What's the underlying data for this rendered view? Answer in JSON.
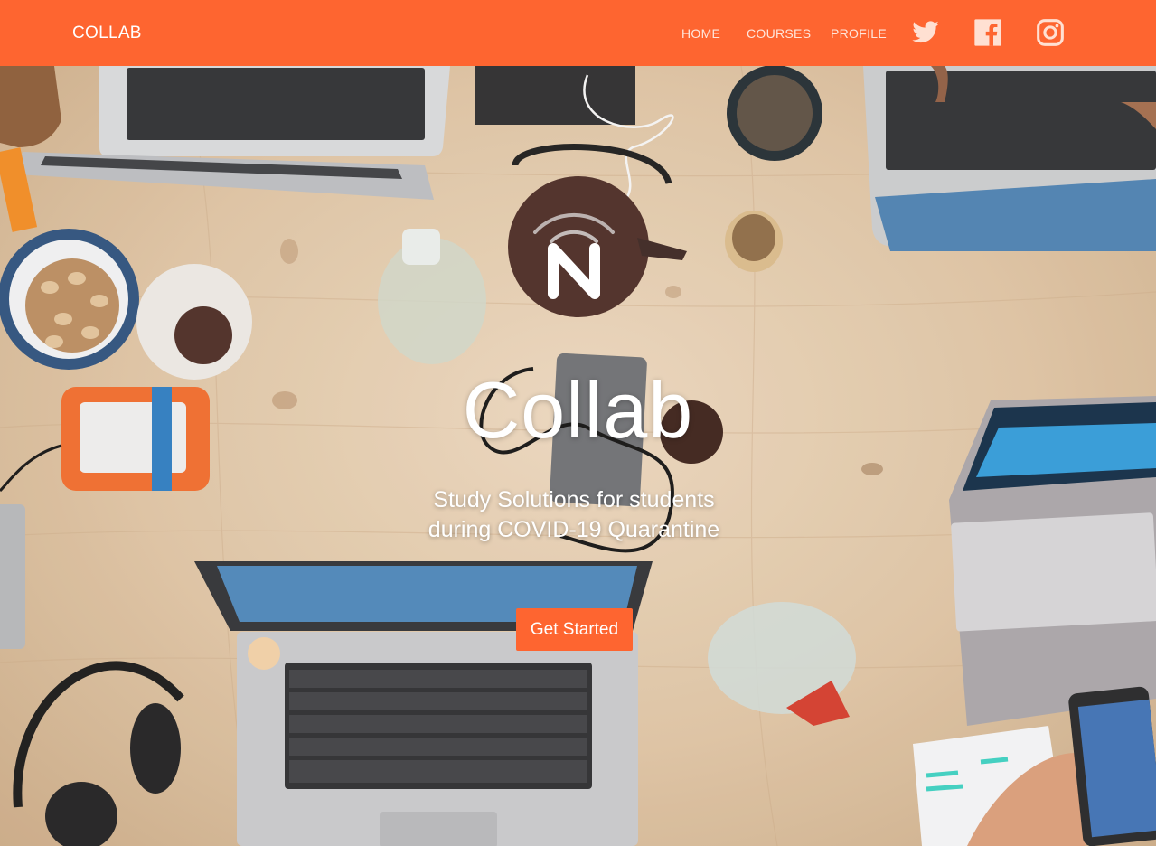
{
  "nav": {
    "brand": "COLLAB",
    "links": [
      {
        "label": "HOME"
      },
      {
        "label": "COURSES"
      },
      {
        "label": "PROFILE"
      }
    ],
    "social": [
      {
        "icon": "twitter-icon"
      },
      {
        "icon": "facebook-icon"
      },
      {
        "icon": "instagram-icon"
      }
    ]
  },
  "hero": {
    "logo_letter": "N",
    "title": "Collab",
    "subtitle_line1": "Study Solutions for students",
    "subtitle_line2": "during COVID-19 Quarantine",
    "cta_label": "Get Started"
  },
  "colors": {
    "accent": "#fe6530",
    "nav_text": "#ffe6dc",
    "hero_text": "#ffffff"
  }
}
